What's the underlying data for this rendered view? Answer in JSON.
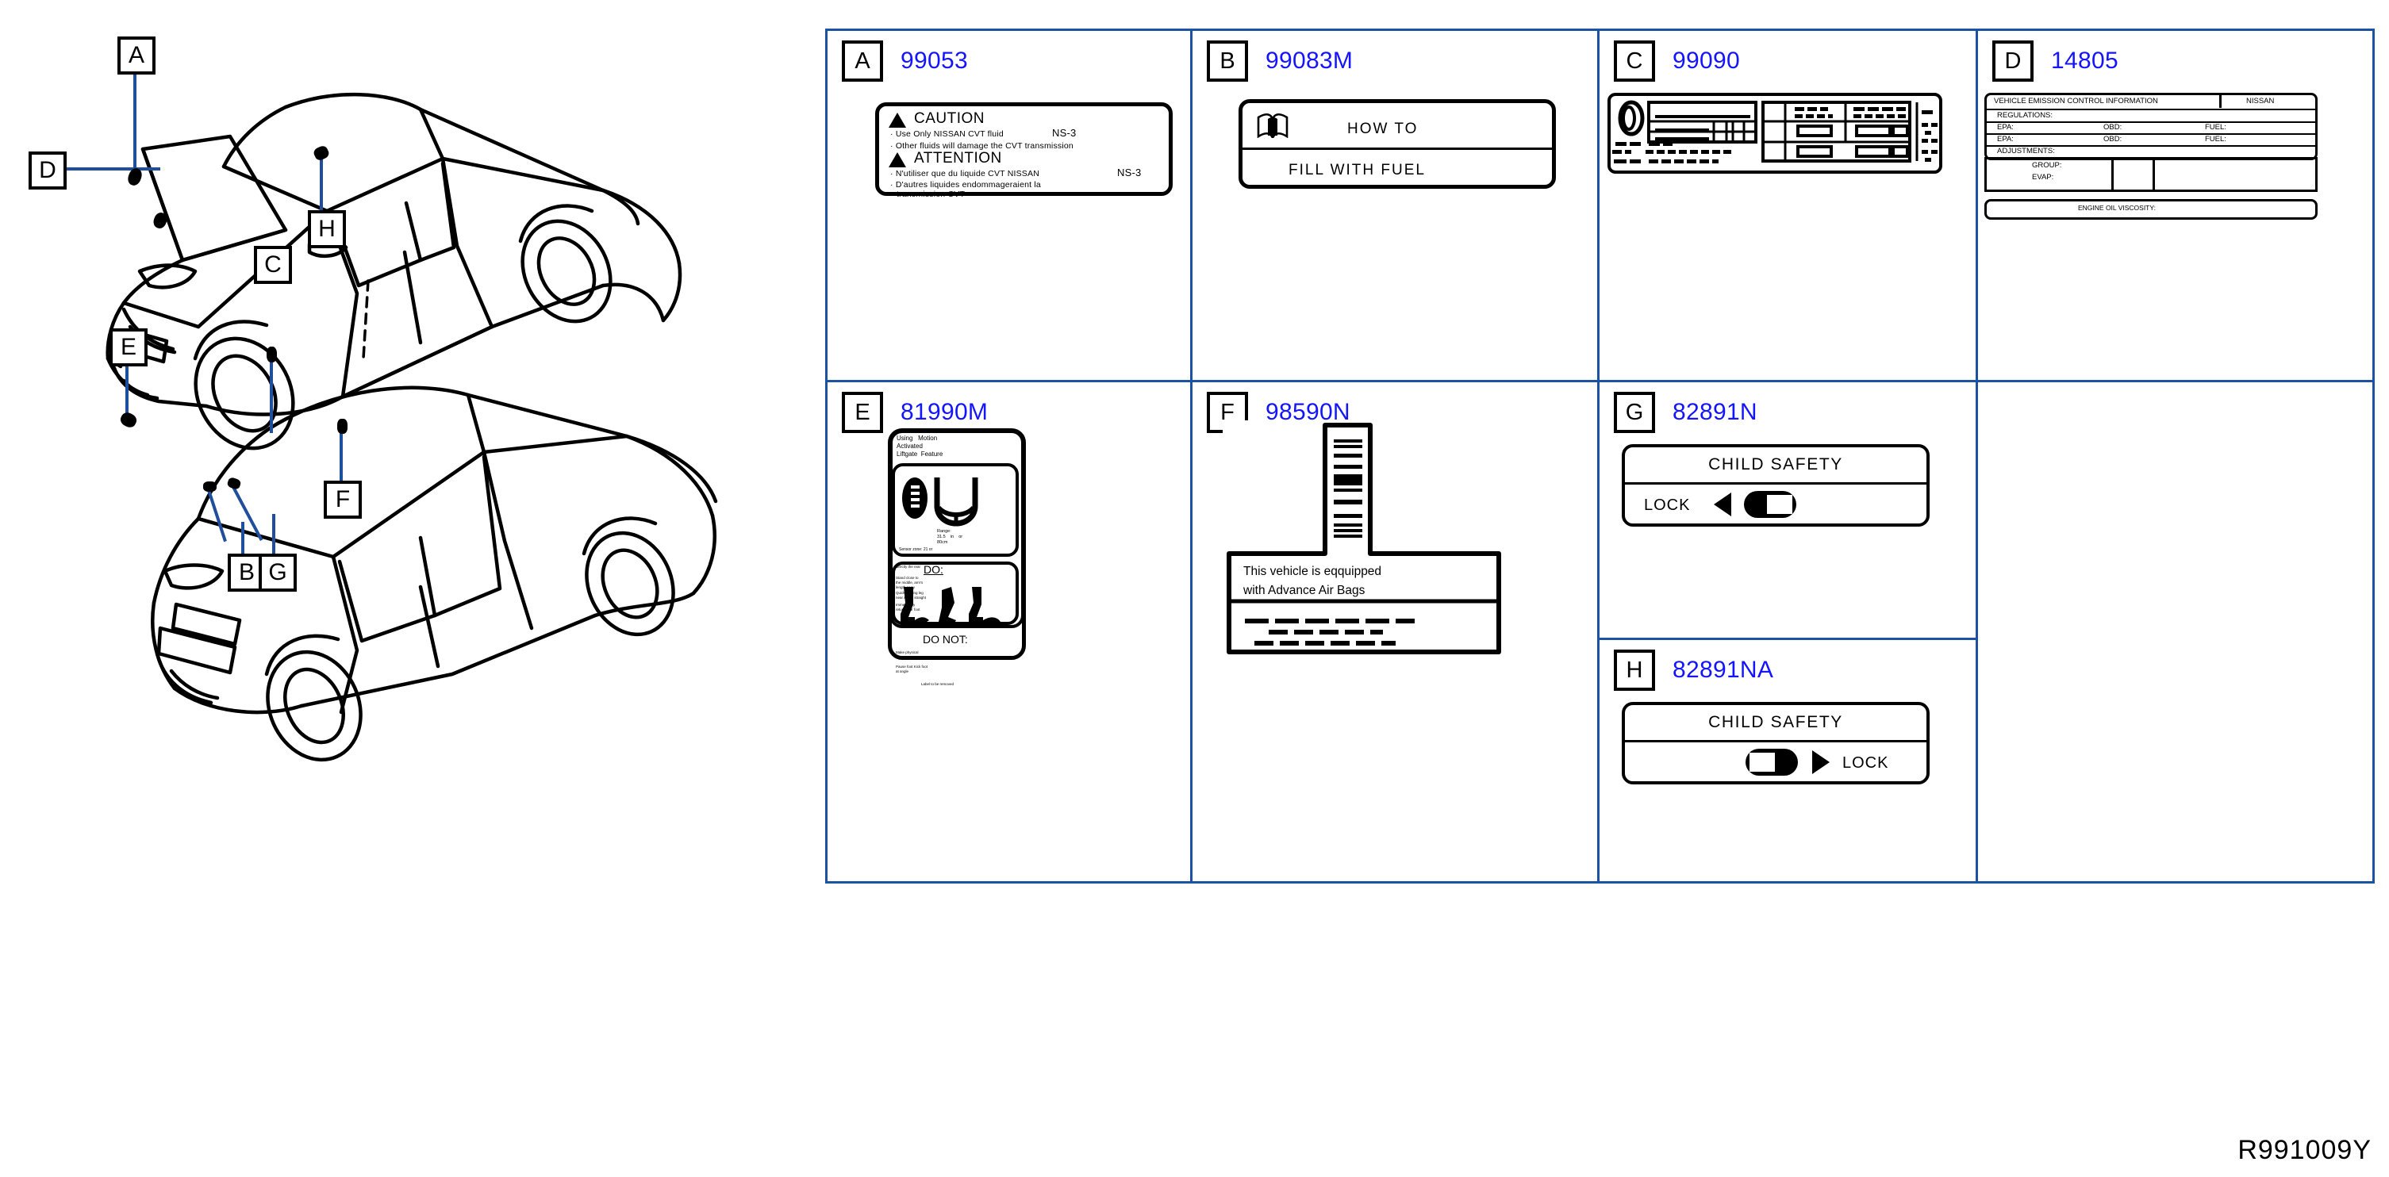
{
  "reference_code": "R991009Y",
  "colors": {
    "grid_border": "#1b52a4",
    "part_number": "#1414ff",
    "leader_line": "#1f4e9c",
    "line_art": "#000000"
  },
  "diagrams": [
    {
      "name": "front-three-quarter-view",
      "callouts": [
        {
          "id": "A",
          "target": "hood-underside-caution-label"
        },
        {
          "id": "D",
          "target": "engine-compartment-emission-label"
        },
        {
          "id": "C",
          "target": "b-pillar-door-jamb"
        },
        {
          "id": "H",
          "target": "rear-wheel-arch"
        }
      ]
    },
    {
      "name": "rear-three-quarter-view",
      "callouts": [
        {
          "id": "E",
          "target": "liftgate-area"
        },
        {
          "id": "F",
          "target": "rear-door-pillar"
        },
        {
          "id": "B",
          "target": "fuel-filler-door"
        },
        {
          "id": "G",
          "target": "rear-door-jamb"
        }
      ]
    }
  ],
  "grid_cells": [
    {
      "letter": "A",
      "part_number": "99053",
      "label_type": "cvt-fluid-caution"
    },
    {
      "letter": "B",
      "part_number": "99083M",
      "label_type": "how-to-fill-fuel"
    },
    {
      "letter": "C",
      "part_number": "99090",
      "label_type": "tire-pressure-placard"
    },
    {
      "letter": "D",
      "part_number": "14805",
      "label_type": "vehicle-emission-control-information"
    },
    {
      "letter": "E",
      "part_number": "81990M",
      "label_type": "motion-activated-liftgate"
    },
    {
      "letter": "F",
      "part_number": "98590N",
      "label_type": "sun-visor-airbag-warning"
    },
    {
      "letter": "G",
      "part_number": "82891N",
      "label_type": "child-safety-lock-left"
    },
    {
      "letter": "H",
      "part_number": "82891NA",
      "label_type": "child-safety-lock-right"
    }
  ],
  "label_A": {
    "caution_heading": "CAUTION",
    "caution_line1": "· Use     Only     NISSAN     CVT     fluid",
    "caution_line1_grade": "NS-3",
    "caution_line2": "· Other     fluids     will     damage     the     CVT     transmission",
    "attention_heading": "ATTENTION",
    "attention_line1": "· N'utiliser     que     du     liquide     CVT     NISSAN",
    "attention_line1_grade": "NS-3",
    "attention_line2": "· D'autres     liquides     endommageraient     la",
    "attention_line3": "transmission     CVT"
  },
  "label_B": {
    "line1": "HOW     TO",
    "line2": "FILL     WITH     FUEL",
    "icon": "open-book-icon"
  },
  "label_D": {
    "title": "VEHICLE    EMISSION    CONTROL    INFORMATION",
    "brand": "NISSAN",
    "regulations": "REGULATIONS:",
    "row_epa_1": "EPA:",
    "row_obd_1": "OBD:",
    "row_fuel_1": "FUEL:",
    "row_epa_2": "EPA:",
    "row_obd_2": "OBD:",
    "row_fuel_2": "FUEL:",
    "adjustments": "ADJUSTMENTS:",
    "group": "GROUP:",
    "evap": "EVAP:",
    "engine_oil": "ENGINE     OIL     VISCOSITY:"
  },
  "label_E": {
    "header_l1": "Using",
    "header_l2": "Motion",
    "header_l3": "Activated",
    "header_l4": "Liftgate",
    "header_l5": "Feature",
    "range_l1": "Range:",
    "range_l2": "31.5",
    "range_l3": "in",
    "range_l4": "or",
    "range_l5": "80cm",
    "sensor_note": "Sensor    zone:    21 or",
    "do_heading": "DO:",
    "do_note_a": "directly    the rear",
    "do_note_b": "Stand    close    to the    middle, arm's    length away",
    "do_note_c": "Quickly    swing    leg near    & foot straight",
    "do_note_d": "Immediately    return your    foot",
    "donot_heading": "DO    NOT:",
    "donot_note_a": "Make    physical contact",
    "donot_note_b": "Pause    foot    Kick    foot    at    angle",
    "footer": "Label    to    be    removed"
  },
  "label_F": {
    "line1": "This     vehicle     is     eqquipped",
    "line2": "with     Advance     Air     Bags"
  },
  "label_G": {
    "title": "CHILD    SAFETY",
    "lock": "LOCK",
    "arrow": "left-arrow-icon",
    "toggle_state": "knob-right"
  },
  "label_H": {
    "title": "CHILD    SAFETY",
    "lock": "LOCK",
    "arrow": "right-arrow-icon",
    "toggle_state": "knob-left"
  }
}
